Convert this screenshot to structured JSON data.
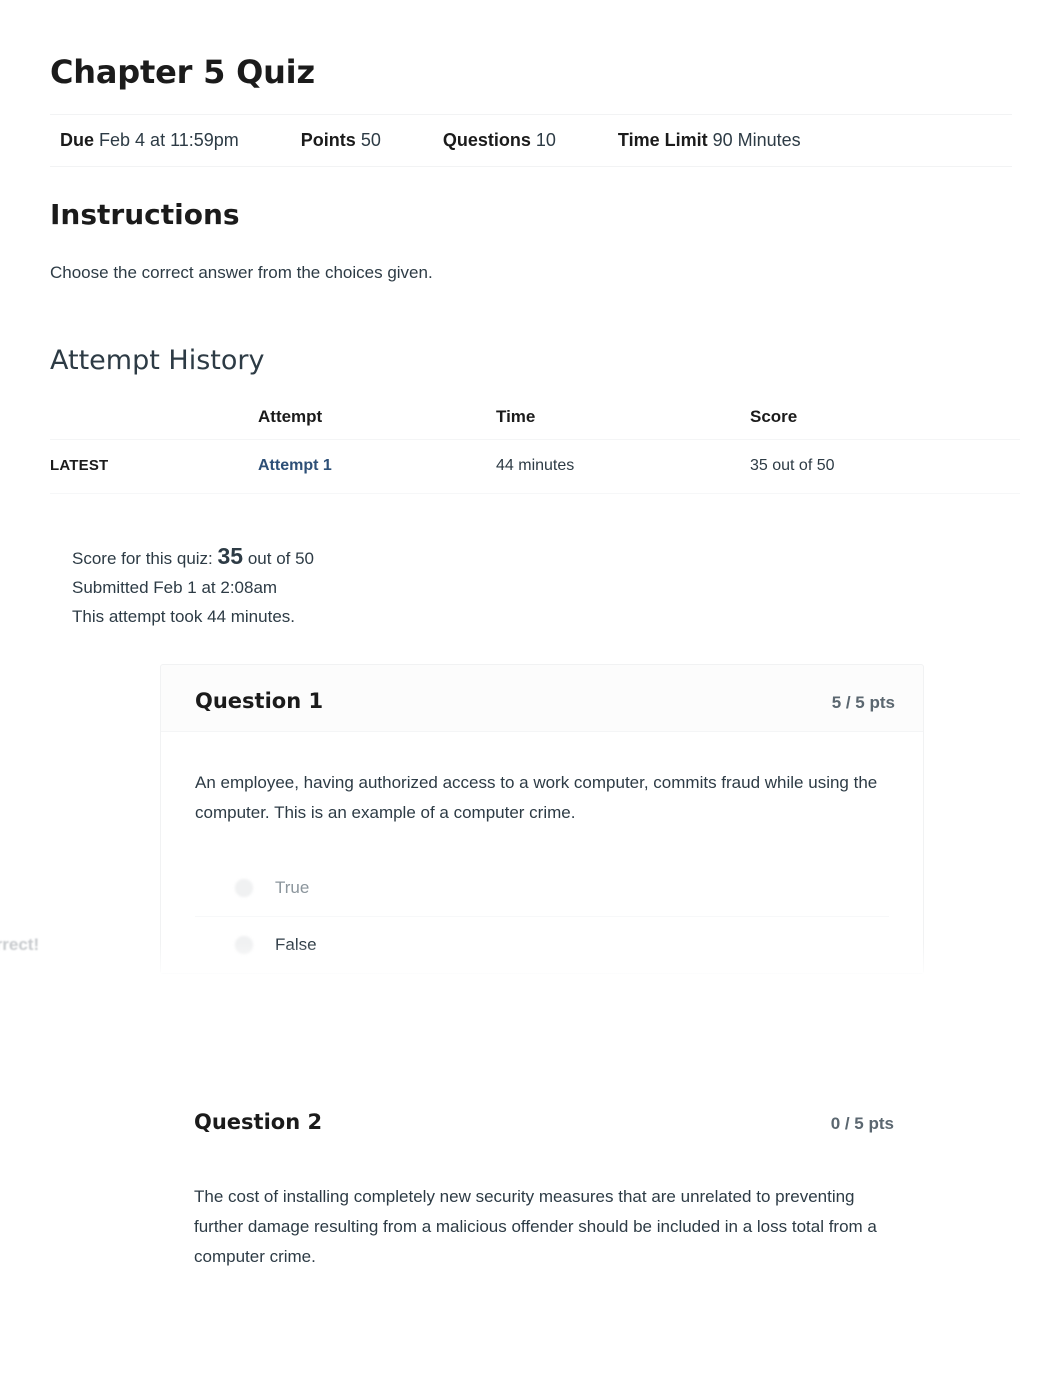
{
  "quiz": {
    "title": "Chapter 5 Quiz",
    "meta": [
      {
        "label": "Due",
        "value": "Feb 4 at 11:59pm"
      },
      {
        "label": "Points",
        "value": "50"
      },
      {
        "label": "Questions",
        "value": "10"
      },
      {
        "label": "Time Limit",
        "value": "90 Minutes"
      }
    ]
  },
  "instructions": {
    "heading": "Instructions",
    "body": "Choose the correct answer from the choices given."
  },
  "attempt_history": {
    "heading": "Attempt History",
    "columns": [
      "",
      "Attempt",
      "Time",
      "Score"
    ],
    "rows": [
      {
        "kept": "LATEST",
        "attempt": "Attempt 1",
        "time": "44 minutes",
        "score": "35 out of 50"
      }
    ]
  },
  "score_summary": {
    "score_prefix": "Score for this quiz:",
    "score_value": "35",
    "score_suffix": "out of 50",
    "submitted": "Submitted Feb 1 at 2:08am",
    "duration": "This attempt took 44 minutes."
  },
  "questions": [
    {
      "name": "Question 1",
      "points": "5 / 5 pts",
      "text": "An employee, having authorized access to a work computer, commits fraud while using the computer. This is an example of a computer crime.",
      "answers": [
        {
          "text": "True",
          "status": "",
          "selected": false
        },
        {
          "text": "False",
          "status": "Correct!",
          "selected": true
        }
      ]
    },
    {
      "name": "Question 2",
      "points": "0 / 5 pts",
      "text": "The cost of installing completely new security measures that are unrelated to preventing further damage resulting from a malicious offender should be included in a loss total from a computer crime.",
      "answers": []
    }
  ],
  "colors": {
    "link": "#2d4f77",
    "text": "#2d3b45",
    "heading": "#1b1b1b",
    "points": "#5b6770",
    "status": "#c8cbce",
    "rule": "#f2f3f4"
  }
}
